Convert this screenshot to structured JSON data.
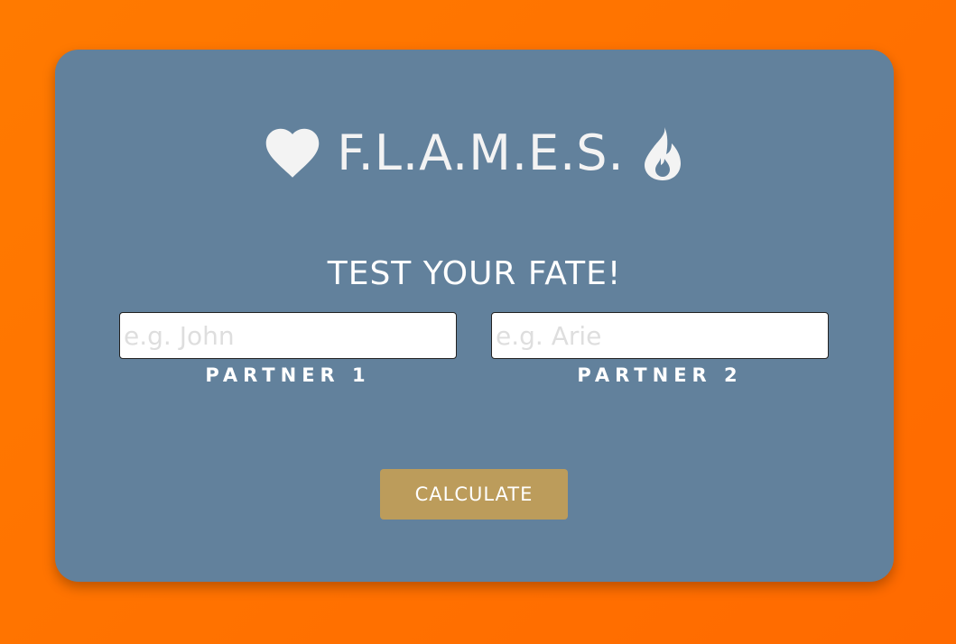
{
  "header": {
    "title": "F.L.A.M.E.S.",
    "left_icon": "heart-icon",
    "right_icon": "fire-icon"
  },
  "subtitle": "TEST YOUR FATE!",
  "form": {
    "partner1": {
      "placeholder": "e.g. John",
      "value": "",
      "label": "PARTNER 1"
    },
    "partner2": {
      "placeholder": "e.g. Arie",
      "value": "",
      "label": "PARTNER 2"
    },
    "submit_label": "CALCULATE"
  },
  "colors": {
    "background": "#ff6f00",
    "card": "#62819c",
    "button": "#bc9c5b",
    "text": "#ffffff"
  }
}
